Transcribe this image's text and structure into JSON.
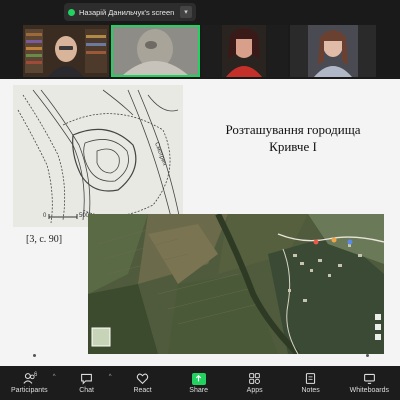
{
  "share_banner": {
    "presenter_screen": "Назарій Данильчук's screen",
    "status_icon": "green-dot-icon",
    "options_icon": "chevron-down-icon"
  },
  "participants_strip": {
    "tiles": [
      {
        "description_icon": "video-tile",
        "active": false
      },
      {
        "description_icon": "video-tile",
        "active": true
      },
      {
        "description_icon": "video-tile",
        "active": false
      },
      {
        "description_icon": "video-tile",
        "active": false
      }
    ],
    "active_border_color": "#23d160"
  },
  "slide": {
    "title_line_1": "Розташування городища",
    "title_line_2": "Кривче І",
    "citation": "[3, с. 90]",
    "scale_label": "500 м",
    "scale_zero": "0"
  },
  "toolbar": {
    "participants_label": "Participants",
    "participants_count": "6",
    "chat_label": "Chat",
    "react_label": "React",
    "share_label": "Share",
    "apps_label": "Apps",
    "notes_label": "Notes",
    "whiteboards_label": "Whiteboards",
    "share_color": "#23d160"
  }
}
